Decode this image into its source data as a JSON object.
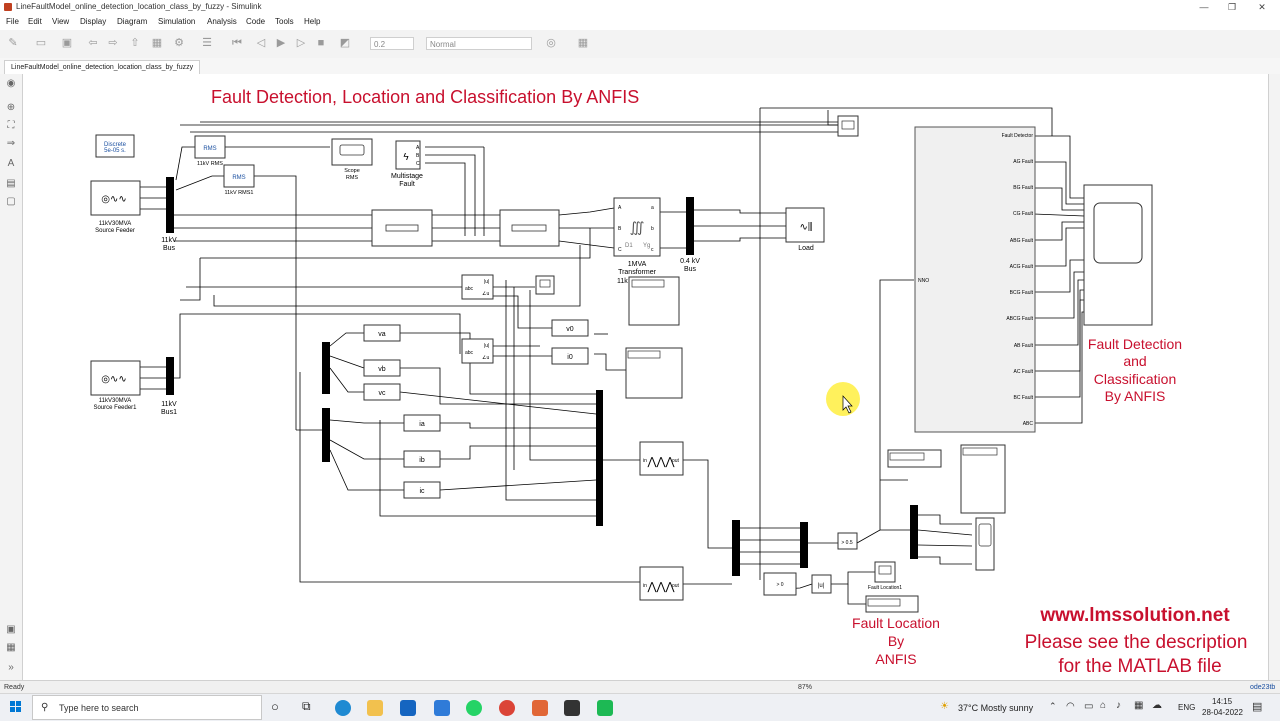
{
  "window": {
    "title": "LineFaultModel_online_detection_location_class_by_fuzzy - Simulink"
  },
  "menu": [
    "File",
    "Edit",
    "View",
    "Display",
    "Diagram",
    "Simulation",
    "Analysis",
    "Code",
    "Tools",
    "Help"
  ],
  "toolbar": {
    "stop_time": "0.2",
    "sim_mode": "Normal"
  },
  "tab": {
    "label": "LineFaultModel_online_detection_location_class_by_fuzzy"
  },
  "diagram": {
    "main_title": "Fault Detection, Location and Classification By ANFIS",
    "detect_label": [
      "Fault Detection",
      "and",
      "Classification",
      "By ANFIS"
    ],
    "location_label": [
      "Fault Location",
      "By",
      "ANFIS"
    ],
    "website": "www.lmssolution.net",
    "desc": [
      "Please see the description",
      "for the MATLAB file"
    ],
    "powergui": [
      "Discrete",
      "5e-05 s."
    ],
    "rms_block": "RMS",
    "rms_labels": [
      "11kV RMS",
      "11kV RMS1"
    ],
    "scope_rms": [
      "Scope",
      "RMS"
    ],
    "multistage": [
      "Multistage",
      "Fault"
    ],
    "sources": [
      [
        "11kV30MVA",
        "Source Feeder"
      ],
      [
        "11kV30MVA",
        "Source Feeder1"
      ]
    ],
    "bus11": [
      "11kV",
      "Bus"
    ],
    "bus1": [
      "11kV",
      "Bus1"
    ],
    "transformer": [
      "1MVA",
      "Transformer",
      "11k"
    ],
    "bus04": [
      "0.4 kV",
      "Bus"
    ],
    "load": "Load",
    "signals": [
      "va",
      "vb",
      "vc",
      "ia",
      "ib",
      "ic",
      "v0",
      "i0"
    ],
    "abc_port": "abc",
    "abs_port": "|u|",
    "ang_port": "∠u",
    "anfis_in": "in",
    "anfis_out": "out",
    "compare": "> 0.5",
    "compare0": "> 0",
    "abs_block": "|u|",
    "fault_location1": "Fault Location1",
    "nno": "NNO",
    "fault_ports": [
      "Fault Detector",
      "AG Fault",
      "BG Fault",
      "CG Fault",
      "ABG Fault",
      "ACG Fault",
      "BCG Fault",
      "ABCG Fault",
      "AB Fault",
      "AC Fault",
      "BC Fault",
      "ABC"
    ],
    "trans_ports": [
      "A",
      "B",
      "C",
      "a",
      "b",
      "c"
    ],
    "trans_code": [
      "D1",
      "Yg"
    ]
  },
  "status": {
    "left": "Ready",
    "zoom": "87%",
    "solver": "ode23tb"
  },
  "taskbar": {
    "search_placeholder": "Type here to search",
    "weather": "37°C  Mostly sunny",
    "lang": "ENG",
    "time": "14:15",
    "date": "28-04-2022"
  },
  "colors": {
    "accent_red": "#c8102e",
    "block_border": "#333333",
    "toolbar_bg": "#f3f3f3"
  }
}
